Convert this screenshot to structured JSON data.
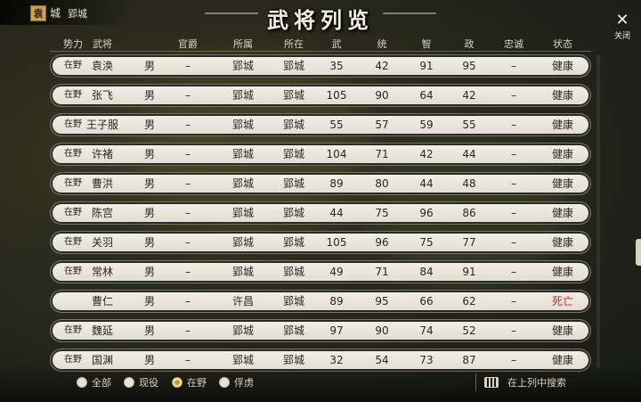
{
  "top_bar": {
    "faction_badge": "袁",
    "city_icon": "城",
    "city_name": "郢城"
  },
  "title": "武将列览",
  "close_label": "关闭",
  "columns": [
    "势力",
    "武将",
    "",
    "官爵",
    "所属",
    "所在",
    "武",
    "统",
    "智",
    "政",
    "忠诚",
    "状态"
  ],
  "rows": [
    {
      "force": "在野",
      "name": "袁涣",
      "gender": "男",
      "rank": "–",
      "belong": "郢城",
      "loc": "郢城",
      "str": "35",
      "lead": "42",
      "int": "91",
      "pol": "95",
      "loyal": "–",
      "status": "健康",
      "dead": false
    },
    {
      "force": "在野",
      "name": "张飞",
      "gender": "男",
      "rank": "–",
      "belong": "郢城",
      "loc": "郢城",
      "str": "105",
      "lead": "90",
      "int": "64",
      "pol": "42",
      "loyal": "–",
      "status": "健康",
      "dead": false
    },
    {
      "force": "在野",
      "name": "王子服",
      "gender": "男",
      "rank": "–",
      "belong": "郢城",
      "loc": "郢城",
      "str": "55",
      "lead": "57",
      "int": "59",
      "pol": "55",
      "loyal": "–",
      "status": "健康",
      "dead": false
    },
    {
      "force": "在野",
      "name": "许褚",
      "gender": "男",
      "rank": "–",
      "belong": "郢城",
      "loc": "郢城",
      "str": "104",
      "lead": "71",
      "int": "42",
      "pol": "44",
      "loyal": "–",
      "status": "健康",
      "dead": false
    },
    {
      "force": "在野",
      "name": "曹洪",
      "gender": "男",
      "rank": "–",
      "belong": "郢城",
      "loc": "郢城",
      "str": "89",
      "lead": "80",
      "int": "44",
      "pol": "48",
      "loyal": "–",
      "status": "健康",
      "dead": false
    },
    {
      "force": "在野",
      "name": "陈宫",
      "gender": "男",
      "rank": "–",
      "belong": "郢城",
      "loc": "郢城",
      "str": "44",
      "lead": "75",
      "int": "96",
      "pol": "86",
      "loyal": "–",
      "status": "健康",
      "dead": false
    },
    {
      "force": "在野",
      "name": "关羽",
      "gender": "男",
      "rank": "–",
      "belong": "郢城",
      "loc": "郢城",
      "str": "105",
      "lead": "96",
      "int": "75",
      "pol": "77",
      "loyal": "–",
      "status": "健康",
      "dead": false
    },
    {
      "force": "在野",
      "name": "常林",
      "gender": "男",
      "rank": "–",
      "belong": "郢城",
      "loc": "郢城",
      "str": "49",
      "lead": "71",
      "int": "84",
      "pol": "91",
      "loyal": "–",
      "status": "健康",
      "dead": false
    },
    {
      "force": "",
      "name": "曹仁",
      "gender": "男",
      "rank": "–",
      "belong": "许昌",
      "loc": "郢城",
      "str": "89",
      "lead": "95",
      "int": "66",
      "pol": "62",
      "loyal": "–",
      "status": "死亡",
      "dead": true
    },
    {
      "force": "在野",
      "name": "魏延",
      "gender": "男",
      "rank": "–",
      "belong": "郢城",
      "loc": "郢城",
      "str": "97",
      "lead": "90",
      "int": "74",
      "pol": "52",
      "loyal": "–",
      "status": "健康",
      "dead": false
    },
    {
      "force": "在野",
      "name": "国渊",
      "gender": "男",
      "rank": "–",
      "belong": "郢城",
      "loc": "郢城",
      "str": "32",
      "lead": "54",
      "int": "73",
      "pol": "87",
      "loyal": "–",
      "status": "健康",
      "dead": false
    }
  ],
  "filters": [
    {
      "label": "全部",
      "checked": false
    },
    {
      "label": "现役",
      "checked": false
    },
    {
      "label": "在野",
      "checked": true
    },
    {
      "label": "俘虏",
      "checked": false
    }
  ],
  "search_label": "在上列中搜索",
  "colors": {
    "dead_status": "#c62828",
    "accent": "#c79a3a"
  }
}
